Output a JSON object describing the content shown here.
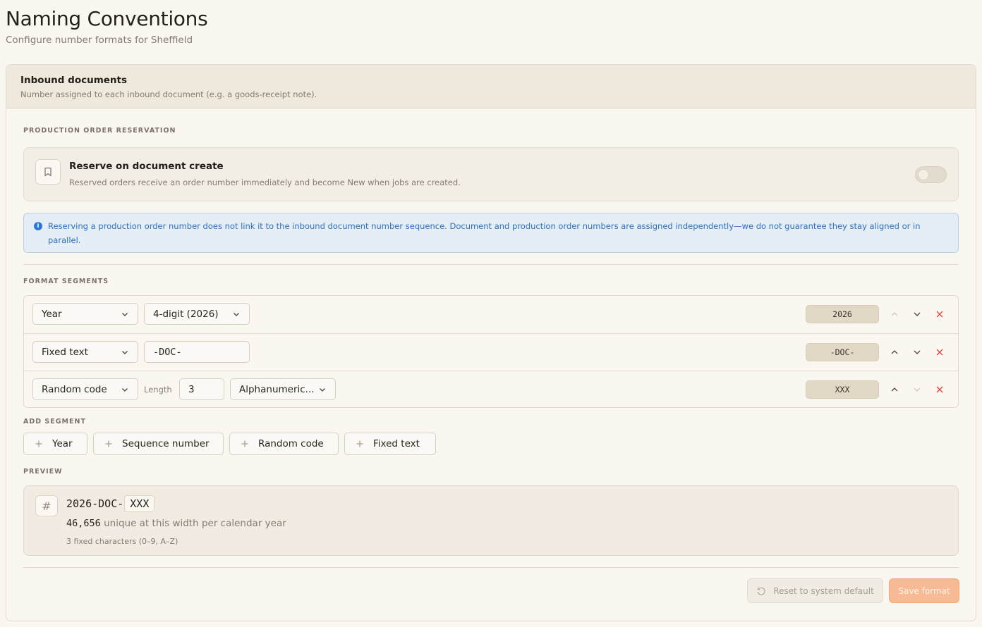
{
  "header": {
    "title": "Naming Conventions",
    "subtitle": "Configure number formats for Sheffield"
  },
  "card": {
    "title": "Inbound documents",
    "description": "Number assigned to each inbound document (e.g. a goods-receipt note)."
  },
  "reservation": {
    "section_label": "PRODUCTION ORDER RESERVATION",
    "icon": "bookmark-icon",
    "title": "Reserve on document create",
    "description": "Reserved orders receive an order number immediately and become New when jobs are created.",
    "enabled": false
  },
  "info": {
    "icon": "info-icon",
    "text": "Reserving a production order number does not link it to the inbound document number sequence. Document and production order numbers are assigned independently—we do not guarantee they stay aligned or in parallel."
  },
  "segments": {
    "section_label": "FORMAT SEGMENTS",
    "rows": [
      {
        "type": "Year",
        "option": "4-digit (2026)",
        "preview": "2026"
      },
      {
        "type": "Fixed text",
        "value": "-DOC-",
        "preview": "-DOC-"
      },
      {
        "type": "Random code",
        "length_label": "Length",
        "length": "3",
        "charset": "Alphanumeric...",
        "preview": "XXX"
      }
    ]
  },
  "add_segment": {
    "section_label": "ADD SEGMENT",
    "buttons": [
      "Year",
      "Sequence number",
      "Random code",
      "Fixed text"
    ]
  },
  "preview": {
    "section_label": "PREVIEW",
    "icon": "#",
    "prefix": "2026-DOC-",
    "random": "XXX",
    "count": "46,656",
    "count_suffix": "unique at this width per calendar year",
    "note": "3 fixed characters (0–9, A–Z)"
  },
  "footer": {
    "reset_label": "Reset to system default",
    "save_label": "Save format"
  },
  "colors": {
    "accent": "#f6bb94",
    "info": "#2b79d6",
    "danger": "#e0413a"
  }
}
